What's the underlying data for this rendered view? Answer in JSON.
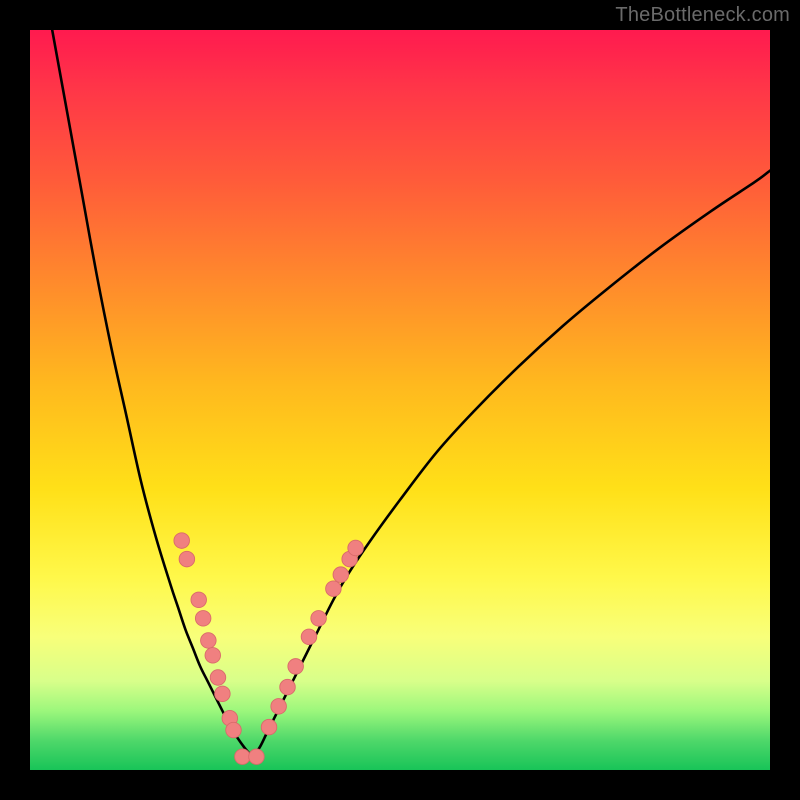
{
  "watermark": "TheBottleneck.com",
  "colors": {
    "curve": "#000000",
    "dot_fill": "#f08080",
    "dot_stroke": "#d96a6a",
    "frame_bg": "#000000"
  },
  "chart_data": {
    "type": "line",
    "title": "",
    "xlabel": "",
    "ylabel": "",
    "xlim": [
      0,
      100
    ],
    "ylim": [
      0,
      100
    ],
    "note": "Two monotone curves meeting near a minimum at x≈26, plus scatter dots lying on the curves near the bottom. Values are read in percent of plot width/height (0,0 at top-left of gradient area).",
    "series": [
      {
        "name": "left_curve",
        "x": [
          3,
          5,
          7,
          9,
          11,
          13,
          15,
          17,
          19,
          20,
          21,
          22,
          23,
          24,
          25,
          26,
          27,
          28,
          29,
          30
        ],
        "y": [
          0,
          11,
          22,
          33,
          43,
          52,
          61,
          68.5,
          75,
          78,
          81,
          83.5,
          86,
          88,
          90,
          92,
          94,
          95.6,
          97,
          98.2
        ]
      },
      {
        "name": "right_curve",
        "x": [
          30,
          31,
          32,
          33,
          35,
          37,
          39,
          41,
          43,
          46,
          50,
          55,
          60,
          66,
          72,
          78,
          85,
          92,
          98,
          100
        ],
        "y": [
          98.2,
          97,
          95,
          93,
          89,
          85,
          81,
          77,
          73.5,
          69,
          63.5,
          57,
          51.5,
          45.5,
          40,
          35,
          29.5,
          24.5,
          20.5,
          19
        ]
      }
    ],
    "scatter": {
      "name": "highlight_dots",
      "points": [
        {
          "x": 20.5,
          "y": 69.0
        },
        {
          "x": 21.2,
          "y": 71.5
        },
        {
          "x": 22.8,
          "y": 77.0
        },
        {
          "x": 23.4,
          "y": 79.5
        },
        {
          "x": 24.1,
          "y": 82.5
        },
        {
          "x": 24.7,
          "y": 84.5
        },
        {
          "x": 25.4,
          "y": 87.5
        },
        {
          "x": 26.0,
          "y": 89.7
        },
        {
          "x": 27.0,
          "y": 93.0
        },
        {
          "x": 27.5,
          "y": 94.6
        },
        {
          "x": 28.7,
          "y": 98.2
        },
        {
          "x": 30.6,
          "y": 98.2
        },
        {
          "x": 32.3,
          "y": 94.2
        },
        {
          "x": 33.6,
          "y": 91.4
        },
        {
          "x": 34.8,
          "y": 88.8
        },
        {
          "x": 35.9,
          "y": 86.0
        },
        {
          "x": 37.7,
          "y": 82.0
        },
        {
          "x": 39.0,
          "y": 79.5
        },
        {
          "x": 41.0,
          "y": 75.5
        },
        {
          "x": 42.0,
          "y": 73.6
        },
        {
          "x": 43.2,
          "y": 71.5
        },
        {
          "x": 44.0,
          "y": 70.0
        }
      ]
    }
  }
}
